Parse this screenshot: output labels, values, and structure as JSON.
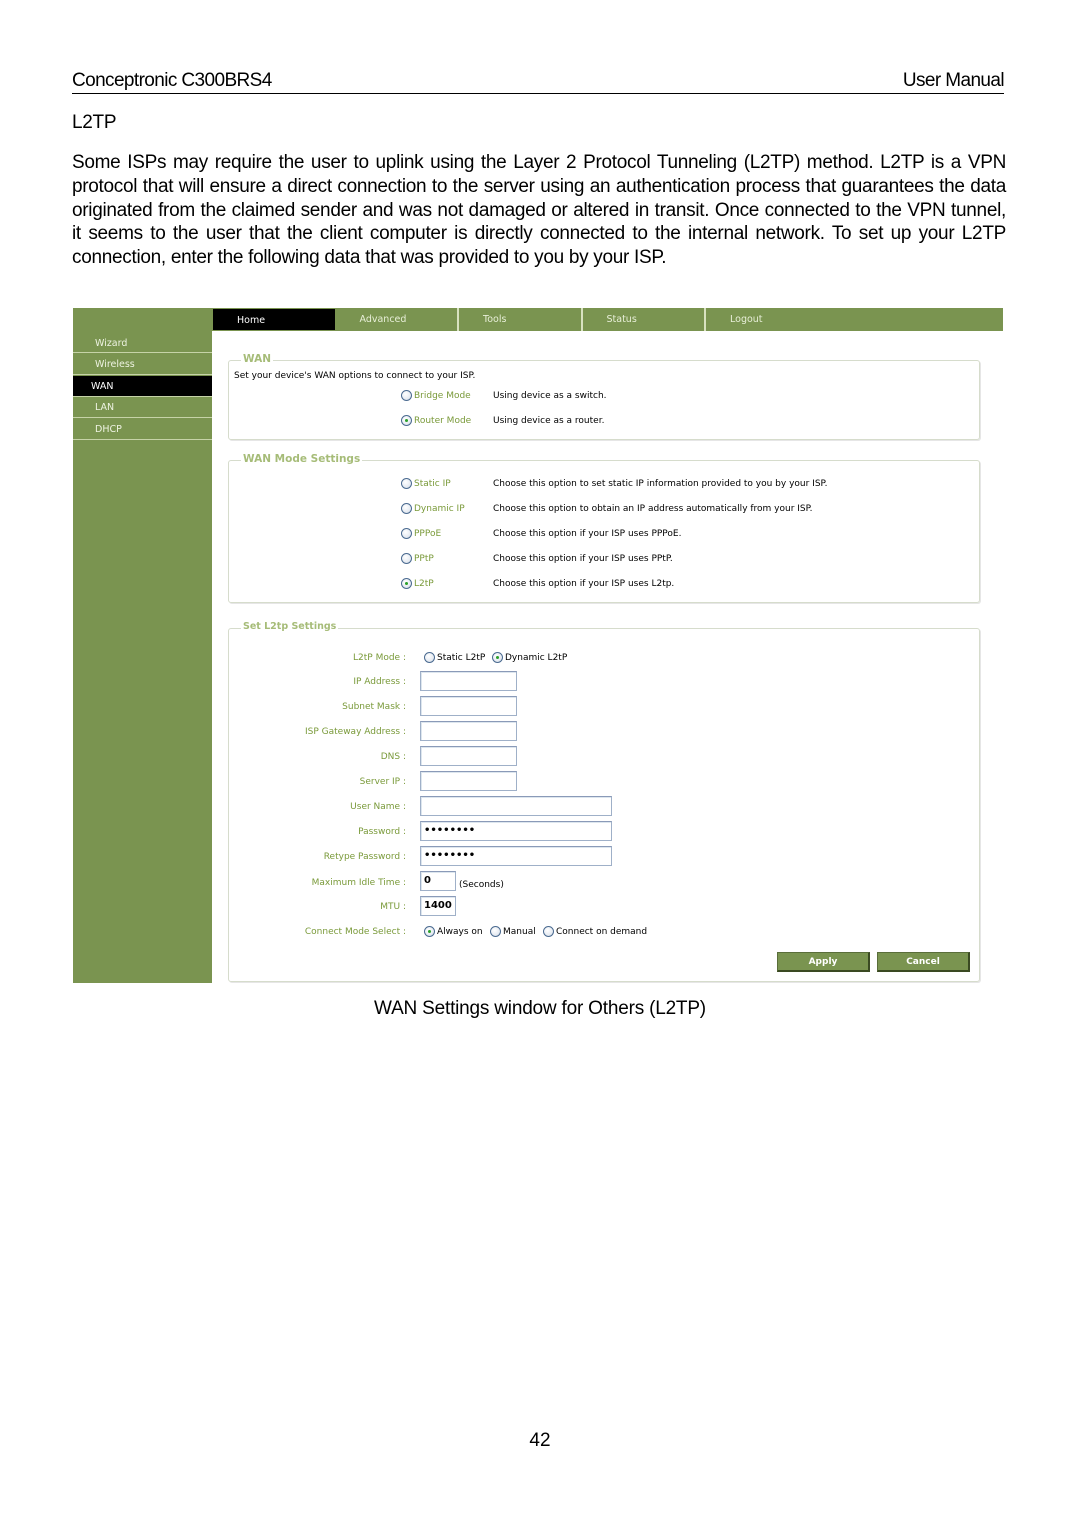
{
  "header": {
    "left": "Conceptronic C300BRS4",
    "right": "User Manual"
  },
  "section_title": "L2TP",
  "intro": "Some ISPs may require the user to uplink using the Layer 2 Protocol Tunneling (L2TP) method. L2TP is a VPN protocol that will ensure a direct connection to the server using an authentication process that guarantees the data originated from the claimed sender and was not damaged or altered in transit. Once connected to the VPN tunnel, it seems to the user that the client computer is directly connected to the internal network. To set up your L2TP connection, enter the following data that was provided to you by your ISP.",
  "screenshot": {
    "topnav": [
      "Home",
      "Advanced",
      "Tools",
      "Status",
      "Logout"
    ],
    "topnav_active": "Home",
    "sidebar": [
      "Wizard",
      "Wireless",
      "WAN",
      "LAN",
      "DHCP"
    ],
    "sidebar_active": "WAN",
    "wan": {
      "legend": "WAN",
      "description": "Set your device's WAN options to connect to your ISP.",
      "options": [
        {
          "label": "Bridge Mode",
          "desc": "Using device as a switch.",
          "checked": false
        },
        {
          "label": "Router Mode",
          "desc": "Using device as a router.",
          "checked": true
        }
      ]
    },
    "wan_mode": {
      "legend": "WAN Mode Settings",
      "options": [
        {
          "label": "Static IP",
          "desc": "Choose this option to set static IP information provided to you by your ISP.",
          "checked": false
        },
        {
          "label": "Dynamic IP",
          "desc": "Choose this option to obtain an IP address automatically from your ISP.",
          "checked": false
        },
        {
          "label": "PPPoE",
          "desc": "Choose this option if your ISP uses PPPoE.",
          "checked": false
        },
        {
          "label": "PPtP",
          "desc": "Choose this option if your ISP uses PPtP.",
          "checked": false
        },
        {
          "label": "L2tP",
          "desc": "Choose this option if your ISP uses L2tp.",
          "checked": true
        }
      ]
    },
    "l2tp": {
      "legend": "Set L2tp Settings",
      "mode_label": "L2tP Mode :",
      "mode_options": [
        {
          "label": "Static L2tP",
          "checked": false
        },
        {
          "label": "Dynamic L2tP",
          "checked": true
        }
      ],
      "fields": {
        "ip_address": {
          "label": "IP Address :",
          "value": ""
        },
        "subnet_mask": {
          "label": "Subnet Mask :",
          "value": ""
        },
        "isp_gateway": {
          "label": "ISP Gateway Address :",
          "value": ""
        },
        "dns": {
          "label": "DNS :",
          "value": ""
        },
        "server_ip": {
          "label": "Server IP :",
          "value": ""
        },
        "user_name": {
          "label": "User Name :",
          "value": ""
        },
        "password": {
          "label": "Password :",
          "value": "••••••••"
        },
        "retype_password": {
          "label": "Retype Password :",
          "value": "••••••••"
        },
        "max_idle": {
          "label": "Maximum Idle Time :",
          "value": "0",
          "unit": "(Seconds)"
        },
        "mtu": {
          "label": "MTU :",
          "value": "1400"
        }
      },
      "connect_mode_label": "Connect Mode Select :",
      "connect_modes": [
        {
          "label": "Always on",
          "checked": true
        },
        {
          "label": "Manual",
          "checked": false
        },
        {
          "label": "Connect on demand",
          "checked": false
        }
      ],
      "apply_label": "Apply",
      "cancel_label": "Cancel"
    }
  },
  "caption": "WAN Settings window for Others (L2TP)",
  "page_number": "42"
}
